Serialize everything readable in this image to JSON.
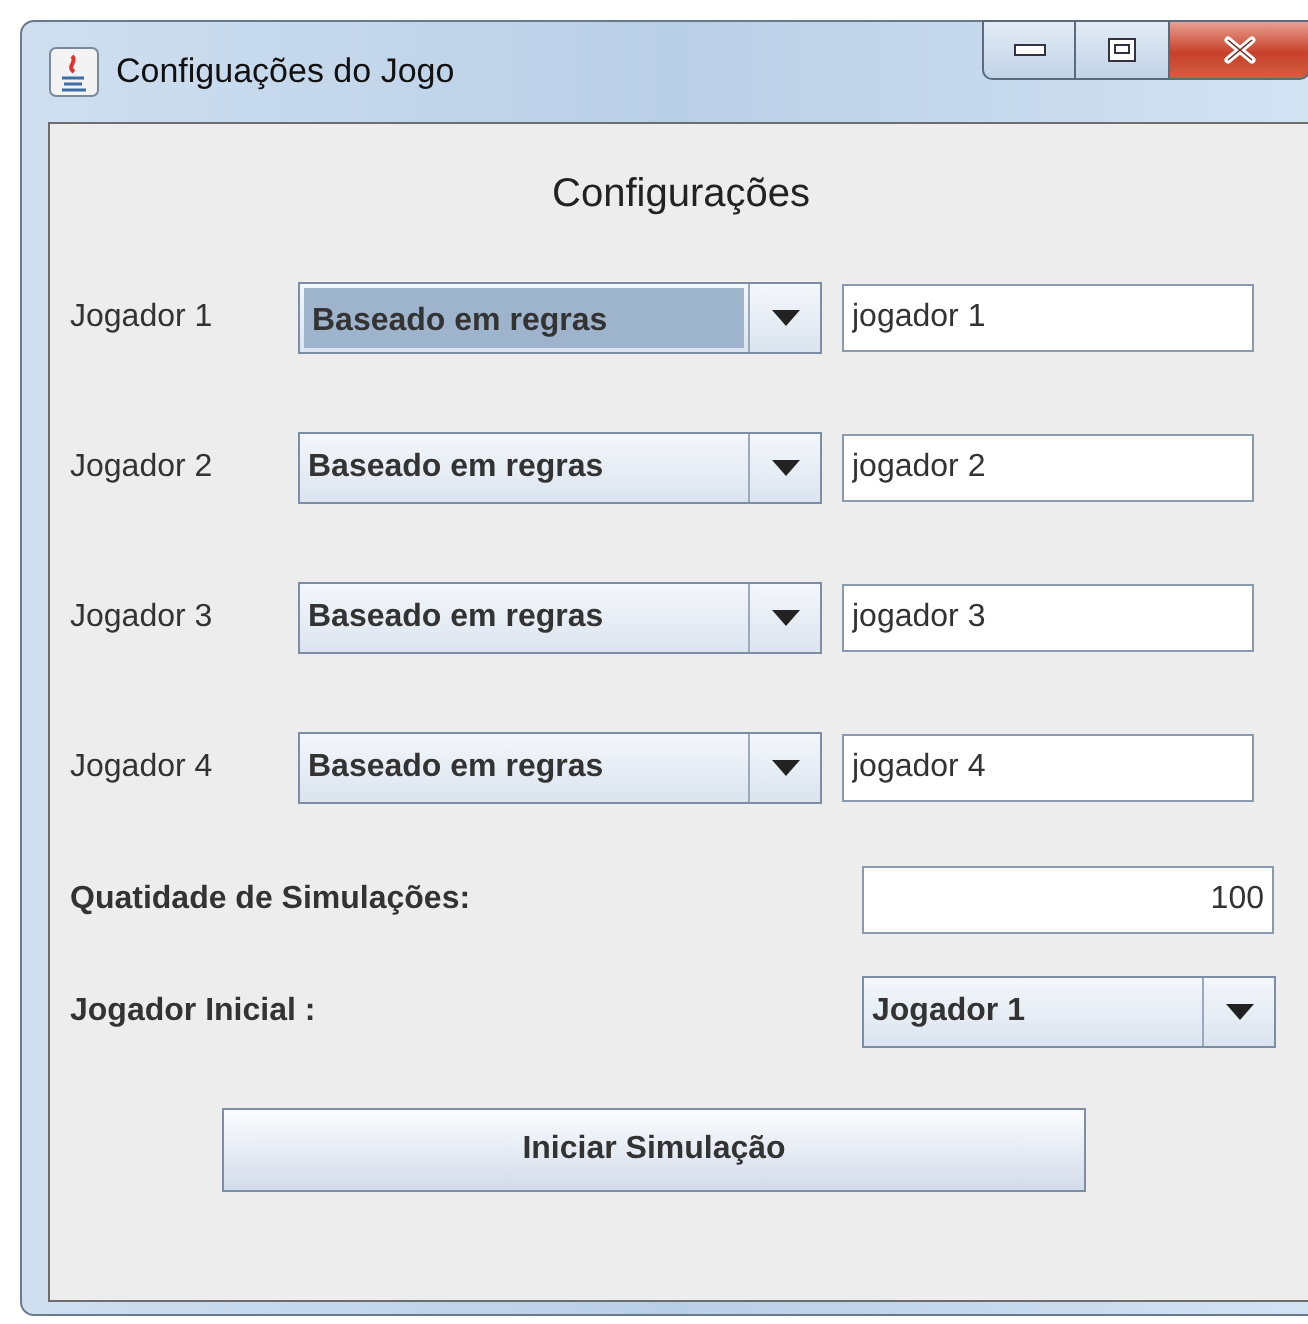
{
  "window": {
    "title": "Configuações do Jogo"
  },
  "heading": "Configurações",
  "players": [
    {
      "label": "Jogador 1",
      "strategy": "Baseado em regras",
      "focused": true,
      "name": "jogador 1"
    },
    {
      "label": "Jogador 2",
      "strategy": "Baseado em regras",
      "focused": false,
      "name": "jogador 2"
    },
    {
      "label": "Jogador 3",
      "strategy": "Baseado em regras",
      "focused": false,
      "name": "jogador 3"
    },
    {
      "label": "Jogador 4",
      "strategy": "Baseado em regras",
      "focused": false,
      "name": "jogador 4"
    }
  ],
  "simulations": {
    "label": "Quatidade de Simulações:",
    "value": "100"
  },
  "initial_player": {
    "label": "Jogador Inicial :",
    "value": "Jogador 1"
  },
  "start_button": "Iniciar Simulação"
}
